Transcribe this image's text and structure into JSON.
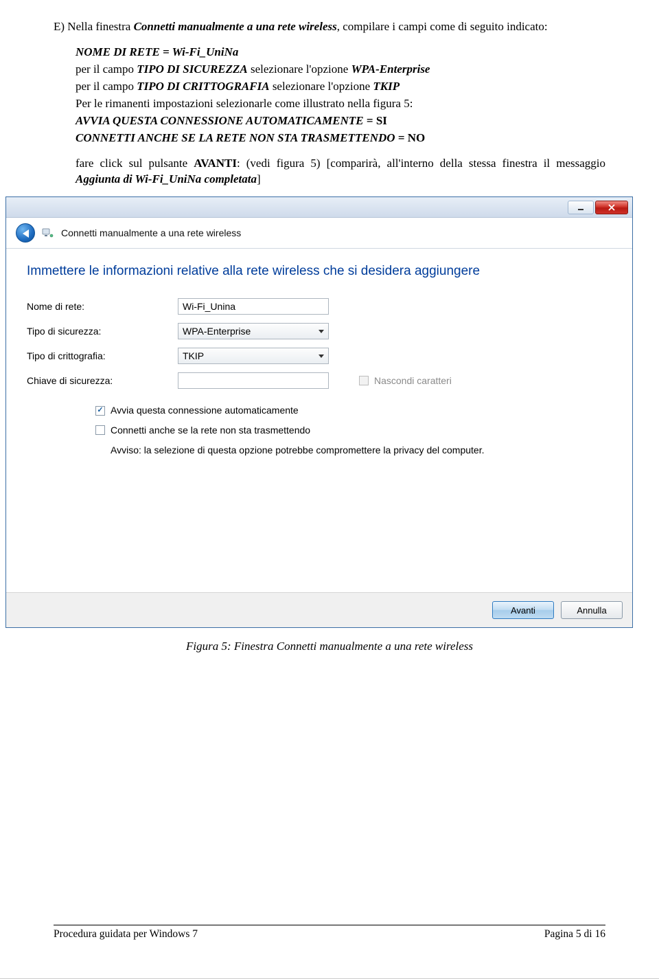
{
  "doc": {
    "lead": "E) Nella finestra ",
    "winname": "Connetti manualmente a una rete wireless",
    "lead2": ", compilare i campi come di seguito indicato:",
    "l1a": "NOME DI RETE = Wi-Fi_UniNa",
    "l2a": "per il campo ",
    "l2b": "TIPO DI SICUREZZA",
    "l2c": " selezionare l'opzione ",
    "l2d": "WPA-Enterprise",
    "l3a": "per il campo ",
    "l3b": "TIPO DI CRITTOGRAFIA",
    "l3c": " selezionare l'opzione ",
    "l3d": "TKIP",
    "l4": "Per le rimanenti impostazioni selezionarle come illustrato nella figura 5:",
    "l5a": "AVVIA QUESTA CONNESSIONE AUTOMATICAMENTE",
    "l5b": " = ",
    "l5c": "SI",
    "l6a": "CONNETTI ANCHE SE LA RETE NON STA TRASMETTENDO",
    "l6b": " = ",
    "l6c": "NO",
    "p2a": "fare click sul pulsante ",
    "p2b": "AVANTI",
    "p2c": ": (vedi figura 5) [comparirà, all'interno della stessa finestra il messaggio ",
    "p2d": "Aggiunta di Wi-Fi_UniNa completata",
    "p2e": "]"
  },
  "win": {
    "title": "Connetti manualmente a una rete wireless",
    "heading": "Immettere le informazioni relative alla rete wireless che si desidera aggiungere",
    "label_name": "Nome di rete:",
    "val_name": "Wi-Fi_Unina",
    "label_sec": "Tipo di sicurezza:",
    "val_sec": "WPA-Enterprise",
    "label_enc": "Tipo di crittografia:",
    "val_enc": "TKIP",
    "label_key": "Chiave di sicurezza:",
    "hide_chars": "Nascondi caratteri",
    "cb_auto": "Avvia questa connessione automaticamente",
    "cb_hidden": "Connetti anche se la rete non sta trasmettendo",
    "warning": "Avviso: la selezione di questa opzione potrebbe compromettere la privacy del computer.",
    "btn_next": "Avanti",
    "btn_cancel": "Annulla"
  },
  "caption": "Figura 5: Finestra Connetti manualmente a una rete wireless",
  "footer": {
    "left": "Procedura guidata per Windows 7",
    "right": "Pagina 5 di 16"
  }
}
